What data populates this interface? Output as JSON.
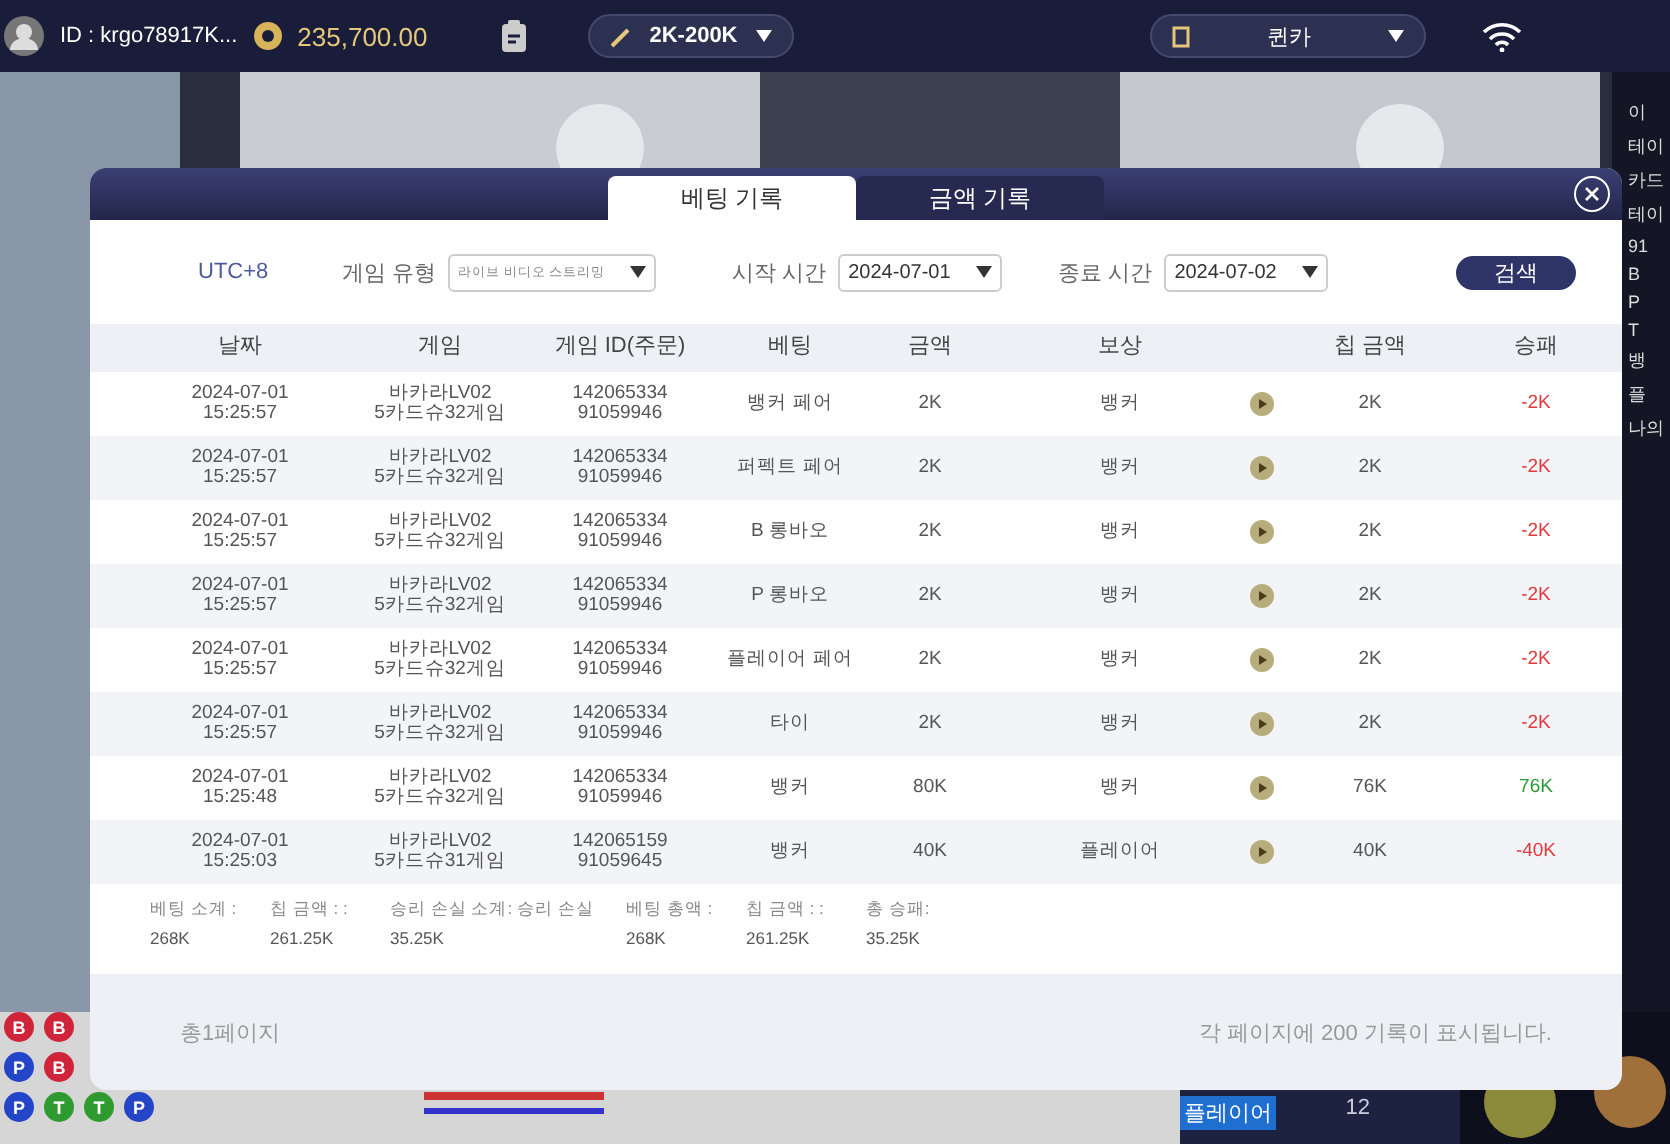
{
  "top_bar": {
    "user_id": "ID : krgo78917K...",
    "balance": "235,700.00",
    "limit": "2K-200K",
    "table": "퀸카"
  },
  "side_panel": {
    "lines": [
      "이",
      "테이",
      "카드",
      "테이",
      "91",
      "B",
      "P",
      "T",
      "뱅",
      "플",
      "나의"
    ]
  },
  "bead_road": [
    [
      {
        "letter": "B",
        "color": "#d0243a"
      },
      {
        "letter": "B",
        "color": "#d0243a"
      }
    ],
    [
      {
        "letter": "P",
        "color": "#2445c8"
      },
      {
        "letter": "B",
        "color": "#d0243a"
      }
    ],
    [
      {
        "letter": "P",
        "color": "#2445c8"
      },
      {
        "letter": "T",
        "color": "#2f9a2f"
      },
      {
        "letter": "T",
        "color": "#2f9a2f"
      },
      {
        "letter": "P",
        "color": "#2445c8"
      }
    ]
  ],
  "score_panel": {
    "label": "플레이어",
    "count": "12"
  },
  "modal": {
    "tabs": [
      {
        "label": "베팅 기록",
        "selected": true
      },
      {
        "label": "금액 기록",
        "selected": false
      }
    ],
    "filters": {
      "timezone": "UTC+8",
      "game_type_label": "게임 유형",
      "game_type": "라이브 비디오 스트리밍",
      "start_label": "시작 시간",
      "start": "2024-07-01",
      "end_label": "종료 시간",
      "end": "2024-07-02",
      "search": "검색"
    },
    "table": {
      "columns": [
        "날짜",
        "게임",
        "게임 ID(주문)",
        "베팅",
        "금액",
        "보상",
        "칩 금액",
        "승패"
      ],
      "rows": [
        {
          "date": "2024-07-01",
          "time": "15:25:57",
          "game": [
            "바카라LV02",
            "5카드슈32게임"
          ],
          "id": [
            "142065334",
            "91059946"
          ],
          "bet": "뱅커 페어",
          "amount": "2K",
          "reward": "뱅커",
          "chip": "2K",
          "result": "-2K",
          "win": false
        },
        {
          "date": "2024-07-01",
          "time": "15:25:57",
          "game": [
            "바카라LV02",
            "5카드슈32게임"
          ],
          "id": [
            "142065334",
            "91059946"
          ],
          "bet": "퍼펙트 페어",
          "amount": "2K",
          "reward": "뱅커",
          "chip": "2K",
          "result": "-2K",
          "win": false
        },
        {
          "date": "2024-07-01",
          "time": "15:25:57",
          "game": [
            "바카라LV02",
            "5카드슈32게임"
          ],
          "id": [
            "142065334",
            "91059946"
          ],
          "bet": "B 롱바오",
          "amount": "2K",
          "reward": "뱅커",
          "chip": "2K",
          "result": "-2K",
          "win": false
        },
        {
          "date": "2024-07-01",
          "time": "15:25:57",
          "game": [
            "바카라LV02",
            "5카드슈32게임"
          ],
          "id": [
            "142065334",
            "91059946"
          ],
          "bet": "P 롱바오",
          "amount": "2K",
          "reward": "뱅커",
          "chip": "2K",
          "result": "-2K",
          "win": false
        },
        {
          "date": "2024-07-01",
          "time": "15:25:57",
          "game": [
            "바카라LV02",
            "5카드슈32게임"
          ],
          "id": [
            "142065334",
            "91059946"
          ],
          "bet": "플레이어 페어",
          "amount": "2K",
          "reward": "뱅커",
          "chip": "2K",
          "result": "-2K",
          "win": false
        },
        {
          "date": "2024-07-01",
          "time": "15:25:57",
          "game": [
            "바카라LV02",
            "5카드슈32게임"
          ],
          "id": [
            "142065334",
            "91059946"
          ],
          "bet": "타이",
          "amount": "2K",
          "reward": "뱅커",
          "chip": "2K",
          "result": "-2K",
          "win": false
        },
        {
          "date": "2024-07-01",
          "time": "15:25:48",
          "game": [
            "바카라LV02",
            "5카드슈32게임"
          ],
          "id": [
            "142065334",
            "91059946"
          ],
          "bet": "뱅커",
          "amount": "80K",
          "reward": "뱅커",
          "chip": "76K",
          "result": "76K",
          "win": true
        },
        {
          "date": "2024-07-01",
          "time": "15:25:03",
          "game": [
            "바카라LV02",
            "5카드슈31게임"
          ],
          "id": [
            "142065159",
            "91059645"
          ],
          "bet": "뱅커",
          "amount": "40K",
          "reward": "플레이어",
          "chip": "40K",
          "result": "-40K",
          "win": false
        }
      ]
    },
    "summary": [
      {
        "label": "베팅 소계 :",
        "value": "268K"
      },
      {
        "label": "칩 금액 : :",
        "value": "261.25K"
      },
      {
        "label": "승리 손실 소계: 승리 손실",
        "value": "35.25K"
      },
      {
        "label": "베팅 총액 :",
        "value": "268K"
      },
      {
        "label": "칩 금액 : :",
        "value": "261.25K"
      },
      {
        "label": "총 승패:",
        "value": "35.25K"
      }
    ],
    "footer": {
      "pages": "총1페이지",
      "per_page": "각 페이지에 200 기록이 표시됩니다."
    }
  }
}
